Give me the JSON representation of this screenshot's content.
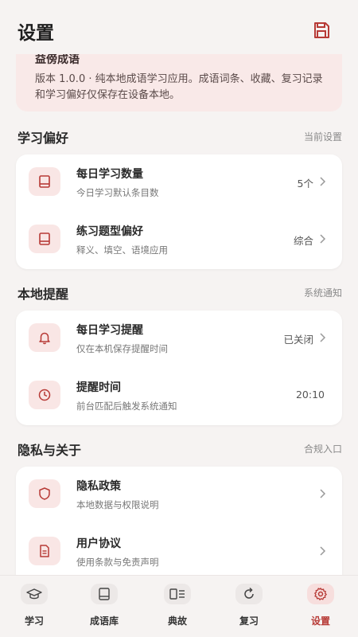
{
  "status_text": "0182c2",
  "header": {
    "title": "设置",
    "save_icon": "save-icon"
  },
  "about": {
    "title": "益傍成语",
    "description": "版本 1.0.0 · 纯本地成语学习应用。成语词条、收藏、复习记录和学习偏好仅保存在设备本地。"
  },
  "sections": {
    "learning": {
      "title": "学习偏好",
      "hint": "当前设置",
      "rows": [
        {
          "title": "每日学习数量",
          "subtitle": "今日学习默认条目数",
          "value": "5个",
          "icon": "book-icon"
        },
        {
          "title": "练习题型偏好",
          "subtitle": "释义、填空、语境应用",
          "value": "综合",
          "icon": "book-icon"
        }
      ]
    },
    "reminder": {
      "title": "本地提醒",
      "hint": "系统通知",
      "rows": [
        {
          "title": "每日学习提醒",
          "subtitle": "仅在本机保存提醒时间",
          "value": "已关闭",
          "icon": "bell-icon"
        },
        {
          "title": "提醒时间",
          "subtitle": "前台匹配后触发系统通知",
          "value": "20:10",
          "icon": "clock-icon"
        }
      ]
    },
    "privacy": {
      "title": "隐私与关于",
      "hint": "合规入口",
      "rows": [
        {
          "title": "隐私政策",
          "subtitle": "本地数据与权限说明",
          "value": "",
          "icon": "shield-icon"
        },
        {
          "title": "用户协议",
          "subtitle": "使用条款与免责声明",
          "value": "",
          "icon": "document-icon"
        }
      ]
    }
  },
  "tabs": [
    {
      "label": "学习",
      "icon": "graduation-cap-icon",
      "active": false
    },
    {
      "label": "成语库",
      "icon": "book-icon",
      "active": false
    },
    {
      "label": "典故",
      "icon": "book-open-icon",
      "active": false
    },
    {
      "label": "复习",
      "icon": "refresh-icon",
      "active": false
    },
    {
      "label": "设置",
      "icon": "gear-icon",
      "active": true
    }
  ],
  "colors": {
    "accent": "#b73a36",
    "background": "#f6f3f2",
    "icon_tile": "#f9e6e5",
    "about_card": "#f9e9e8"
  }
}
